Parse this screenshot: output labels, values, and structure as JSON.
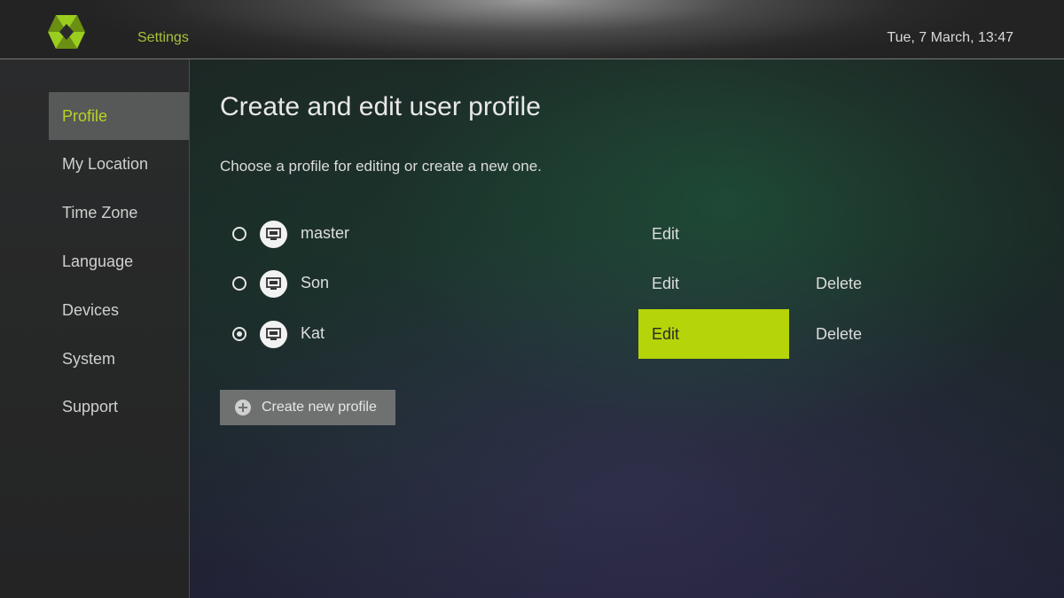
{
  "header": {
    "title": "Settings",
    "clock": "Tue, 7 March, 13:47",
    "logo_icon": "brand-logo",
    "accent_color": "#a7c23a"
  },
  "sidebar": {
    "items": [
      {
        "label": "Profile",
        "active": true
      },
      {
        "label": "My Location",
        "active": false
      },
      {
        "label": "Time Zone",
        "active": false
      },
      {
        "label": "Language",
        "active": false
      },
      {
        "label": "Devices",
        "active": false
      },
      {
        "label": "System",
        "active": false
      },
      {
        "label": "Support",
        "active": false
      }
    ]
  },
  "main": {
    "title": "Create and edit user profile",
    "subtitle": "Choose a profile for editing or create a new one.",
    "profiles": [
      {
        "name": "master",
        "selected": false,
        "edit_label": "Edit",
        "delete_label": ""
      },
      {
        "name": "Son",
        "selected": false,
        "edit_label": "Edit",
        "delete_label": "Delete"
      },
      {
        "name": "Kat",
        "selected": true,
        "edit_label": "Edit",
        "delete_label": "Delete",
        "focused": "edit"
      }
    ],
    "create_button_label": "Create new profile",
    "create_button_icon": "plus-circle-icon",
    "profile_icon": "tv-icon",
    "focus_color": "#b5d40a"
  }
}
